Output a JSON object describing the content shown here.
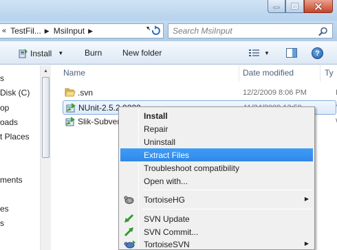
{
  "window": {
    "controls": {
      "minimize_icon": "minimize-icon",
      "maximize_icon": "maximize-icon",
      "close_icon": "close-icon"
    }
  },
  "address": {
    "overflow": "«",
    "crumbs": [
      "TestFil...",
      "MsiInput"
    ],
    "search_placeholder": "Search MsiInput"
  },
  "toolbar": {
    "install_label": "Install",
    "burn_label": "Burn",
    "new_folder_label": "New folder"
  },
  "nav": {
    "items": [
      "s",
      "Disk (C)",
      "op",
      "oads",
      "t Places",
      "ments",
      "es",
      "s"
    ]
  },
  "columns": {
    "name": "Name",
    "date": "Date modified",
    "type": "Ty"
  },
  "files": [
    {
      "name": ".svn",
      "date": "12/2/2009 8:06 PM",
      "type": "Fil",
      "icon": "folder-icon"
    },
    {
      "name": "NUnit-2.5.2.9222",
      "date": "11/24/2009 12:59",
      "type": "W",
      "icon": "msi-package-icon"
    },
    {
      "name": "Slik-Subver",
      "date": "",
      "type": "W",
      "icon": "msi-package-icon"
    }
  ],
  "context_menu": {
    "items": [
      {
        "label": "Install",
        "bold": true
      },
      {
        "label": "Repair"
      },
      {
        "label": "Uninstall"
      },
      {
        "label": "Extract Files",
        "highlighted": true
      },
      {
        "label": "Troubleshoot compatibility"
      },
      {
        "label": "Open with..."
      },
      {
        "label": "TortoiseHG",
        "submenu": true,
        "icon": "tortoisehg-icon"
      },
      {
        "label": "SVN Update",
        "icon": "svn-update-icon"
      },
      {
        "label": "SVN Commit...",
        "icon": "svn-commit-icon"
      },
      {
        "label": "TortoiseSVN",
        "submenu": true,
        "icon": "tortoisesvn-icon"
      }
    ]
  },
  "colors": {
    "selection": "#3399ff",
    "menu_bg": "#f0f0f0",
    "header_text": "#4c607a"
  }
}
